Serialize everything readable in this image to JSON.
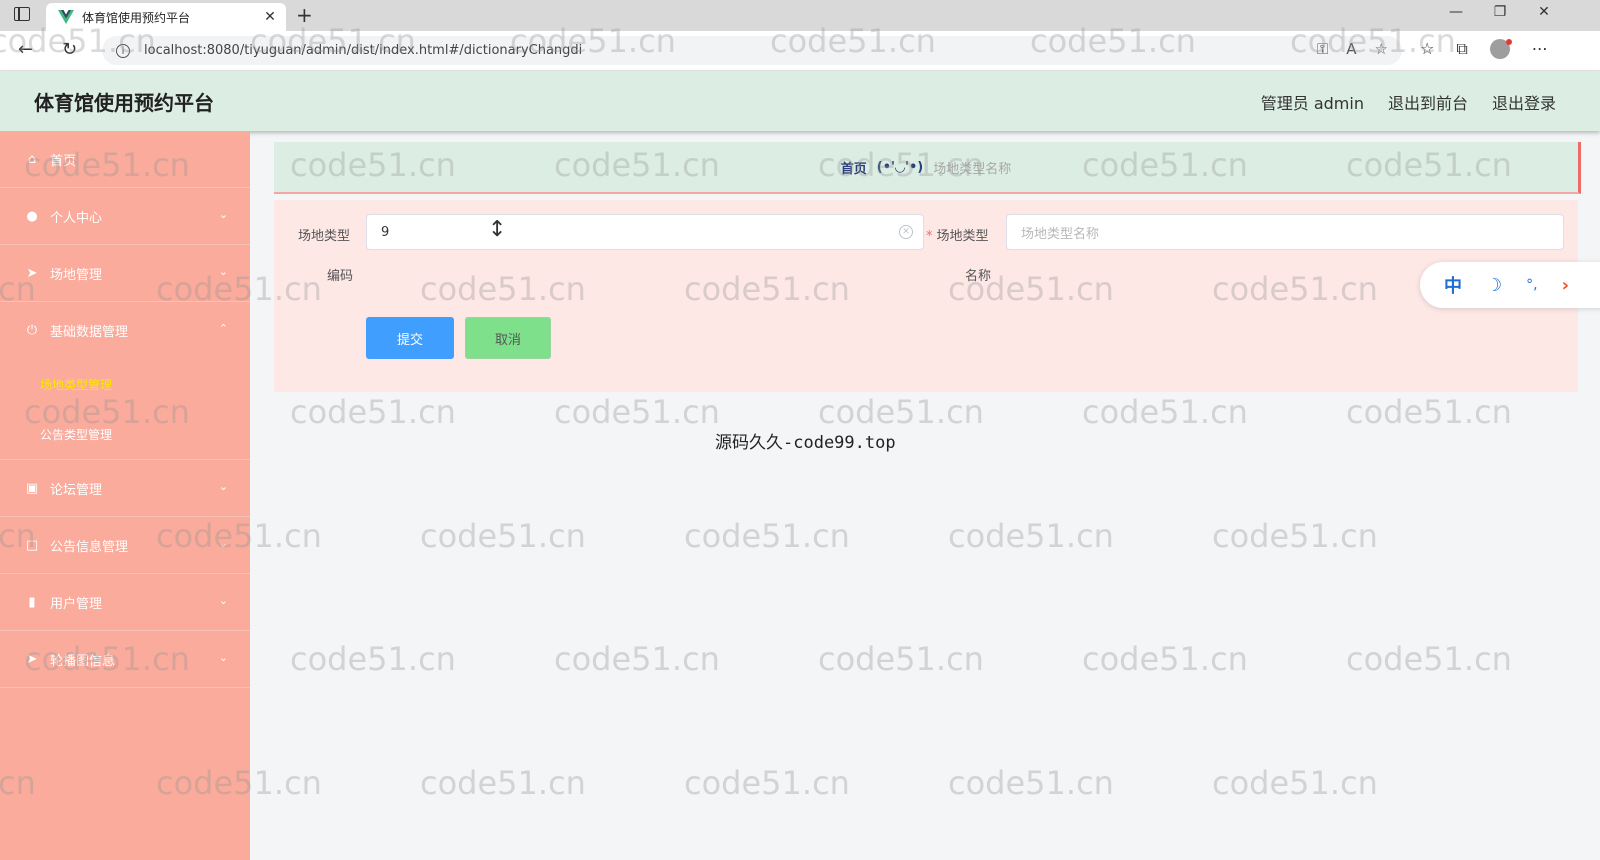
{
  "browser": {
    "tab_title": "体育馆使用预约平台",
    "url": "localhost:8080/tiyuguan/admin/dist/index.html#/dictionaryChangdi"
  },
  "header": {
    "title": "体育馆使用预约平台",
    "links": [
      "管理员 admin",
      "退出到前台",
      "退出登录"
    ]
  },
  "sidebar": {
    "items": [
      {
        "label": "首页",
        "icon": "home-icon"
      },
      {
        "label": "个人中心",
        "icon": "user-icon"
      },
      {
        "label": "场地管理",
        "icon": "send-icon"
      },
      {
        "label": "基础数据管理",
        "icon": "power-icon"
      },
      {
        "label": "论坛管理",
        "icon": "clipboard-icon"
      },
      {
        "label": "公告信息管理",
        "icon": "square-icon"
      },
      {
        "label": "用户管理",
        "icon": "bar-chart-icon"
      },
      {
        "label": "轮播图信息",
        "icon": "send-icon"
      }
    ],
    "sub_items": [
      {
        "label": "场地类型管理",
        "active": true
      },
      {
        "label": "公告类型管理",
        "active": false
      }
    ]
  },
  "breadcrumb": {
    "home": "首页",
    "separator": "(•'◡'•)",
    "current": "场地类型名称"
  },
  "form": {
    "code_label_1": "场地类型",
    "code_label_2": "编码",
    "code_value": "9",
    "name_label_1": "场地类型",
    "name_label_2": "名称",
    "name_placeholder": "场地类型名称",
    "submit": "提交",
    "cancel": "取消"
  },
  "ime": {
    "zh": "中",
    "moon": "☽",
    "dots": "°,",
    "arrow": "›"
  },
  "footer_text": "源码久久-code99.top",
  "watermark": "code51.cn",
  "colors": {
    "sidebar": "#fbab9c",
    "header": "#dceee4",
    "primary": "#409eff",
    "cancel": "#7ee08a",
    "active_sub": "#ffe600"
  }
}
